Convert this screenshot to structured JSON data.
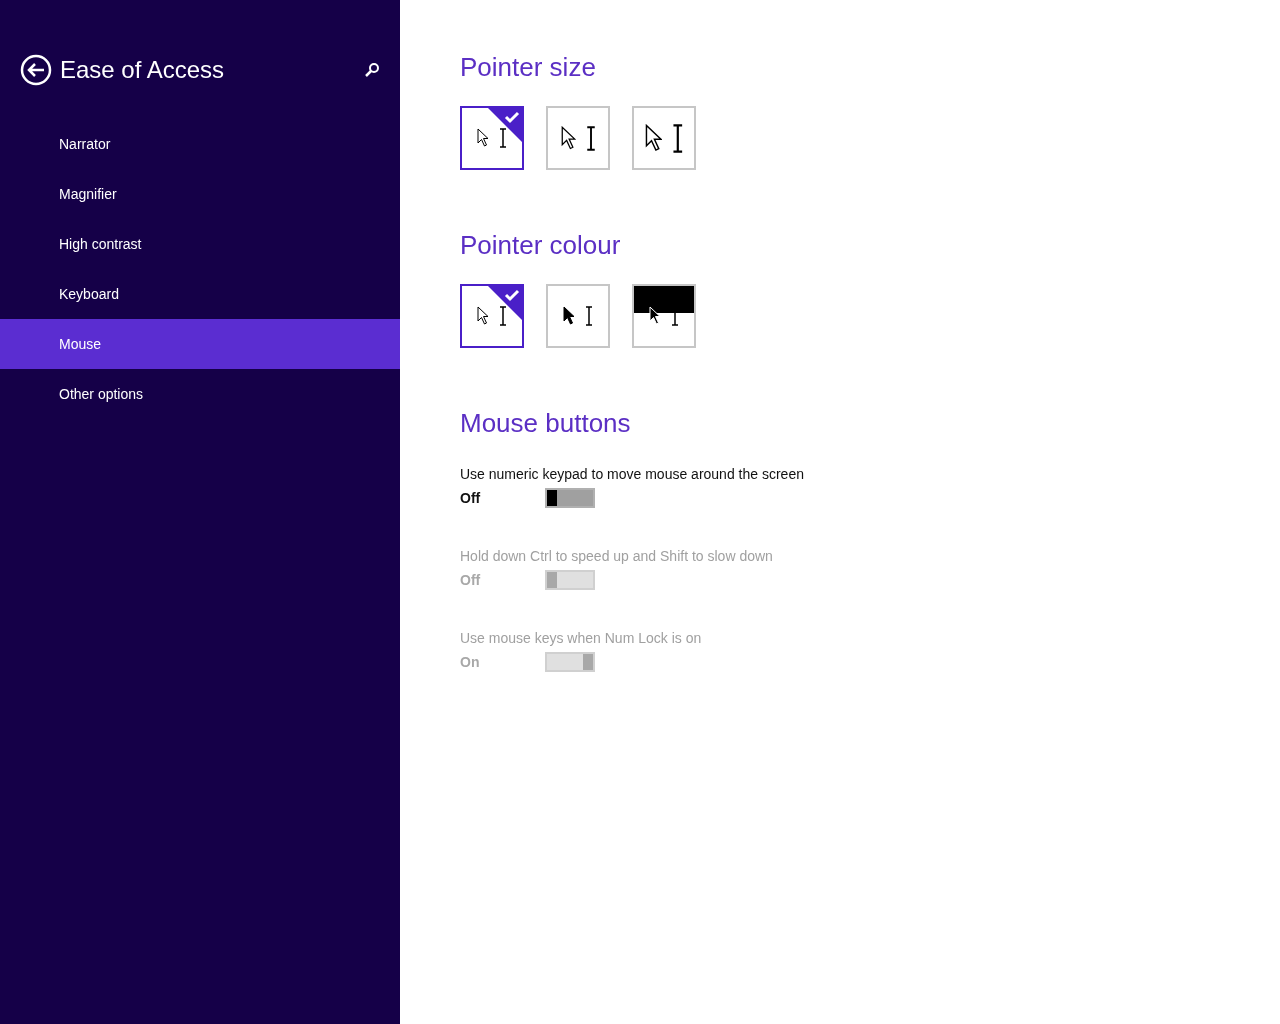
{
  "sidebar": {
    "title": "Ease of Access",
    "items": [
      {
        "label": "Narrator",
        "selected": false
      },
      {
        "label": "Magnifier",
        "selected": false
      },
      {
        "label": "High contrast",
        "selected": false
      },
      {
        "label": "Keyboard",
        "selected": false
      },
      {
        "label": "Mouse",
        "selected": true
      },
      {
        "label": "Other options",
        "selected": false
      }
    ]
  },
  "pointer_size": {
    "heading": "Pointer size",
    "options": [
      {
        "kind": "small",
        "selected": true
      },
      {
        "kind": "medium",
        "selected": false
      },
      {
        "kind": "large",
        "selected": false
      }
    ]
  },
  "pointer_colour": {
    "heading": "Pointer colour",
    "options": [
      {
        "kind": "white",
        "selected": true
      },
      {
        "kind": "black",
        "selected": false
      },
      {
        "kind": "inverted",
        "selected": false
      }
    ]
  },
  "mouse_buttons": {
    "heading": "Mouse buttons",
    "settings": [
      {
        "label": "Use numeric keypad to move mouse around the screen",
        "state": "Off",
        "on": false,
        "disabled": false
      },
      {
        "label": "Hold down Ctrl to speed up and Shift to slow down",
        "state": "Off",
        "on": false,
        "disabled": true
      },
      {
        "label": "Use mouse keys when Num Lock is on",
        "state": "On",
        "on": true,
        "disabled": true
      }
    ]
  }
}
